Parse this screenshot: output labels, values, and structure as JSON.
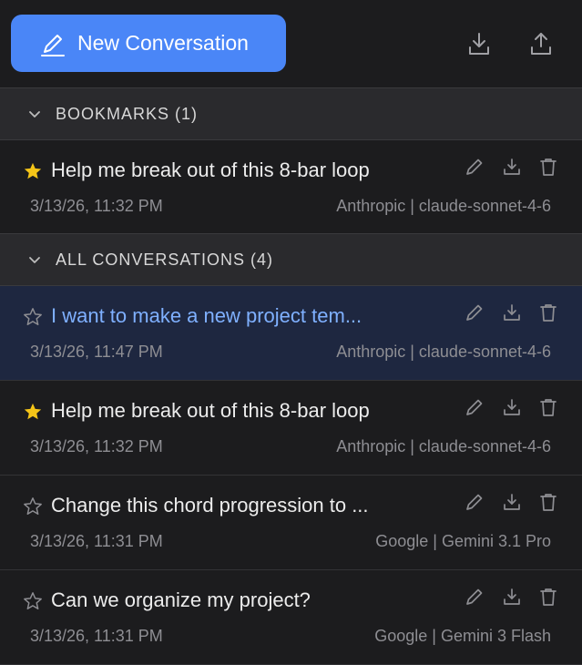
{
  "toolbar": {
    "new_label": "New Conversation",
    "download_icon": "download-icon",
    "upload_icon": "upload-icon"
  },
  "bookmarks": {
    "title": "BOOKMARKS (1)",
    "items": [
      {
        "title": "Help me break out of this 8-bar loop",
        "date": "3/13/26, 11:32 PM",
        "model": "Anthropic | claude-sonnet-4-6",
        "starred": true
      }
    ]
  },
  "all": {
    "title": "ALL CONVERSATIONS (4)",
    "items": [
      {
        "title": "I want to make a new project tem...",
        "date": "3/13/26, 11:47 PM",
        "model": "Anthropic | claude-sonnet-4-6",
        "starred": false,
        "active": true
      },
      {
        "title": "Help me break out of this 8-bar loop",
        "date": "3/13/26, 11:32 PM",
        "model": "Anthropic | claude-sonnet-4-6",
        "starred": true
      },
      {
        "title": "Change this chord progression to ...",
        "date": "3/13/26, 11:31 PM",
        "model": "Google | Gemini 3.1 Pro",
        "starred": false
      },
      {
        "title": "Can we organize my project?",
        "date": "3/13/26, 11:31 PM",
        "model": "Google | Gemini 3 Flash",
        "starred": false
      }
    ]
  },
  "colors": {
    "accent": "#4a86f7",
    "star": "#f5c518",
    "active_bg": "#1e2740",
    "active_title": "#7fb0ff"
  }
}
